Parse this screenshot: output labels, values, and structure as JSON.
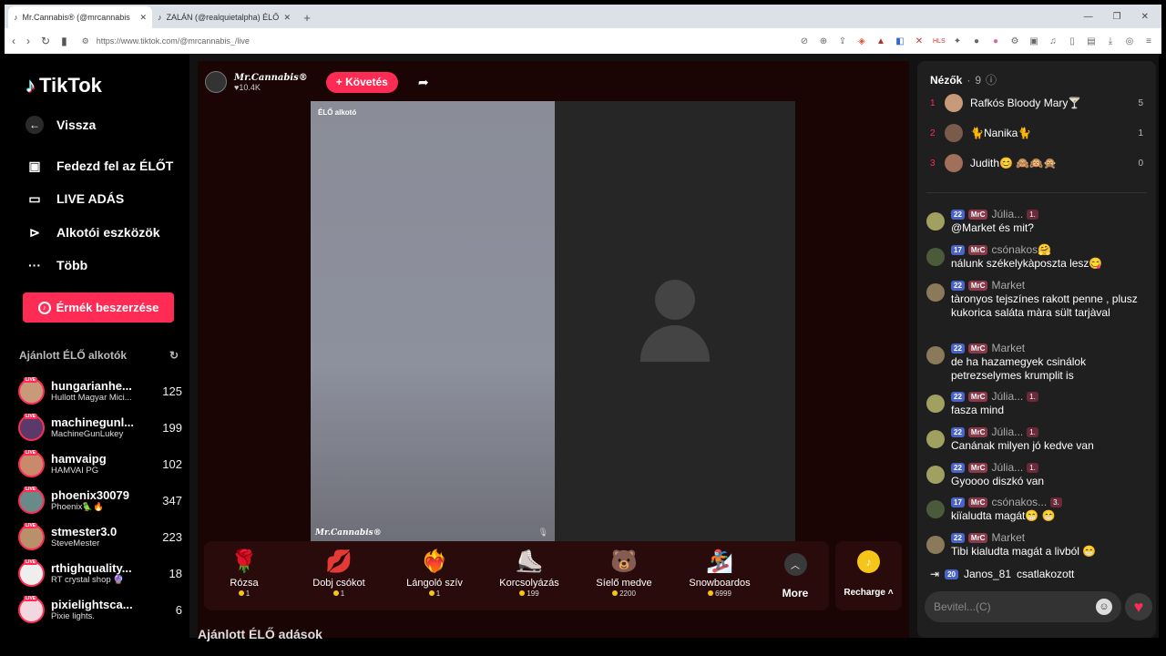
{
  "browser": {
    "tabs": [
      {
        "title": "Mr.Cannabis® (@mrcannabis"
      },
      {
        "title": "ZALÁN (@realquietalpha) ÉLŐ"
      }
    ],
    "url": "https://www.tiktok.com/@mrcannabis_/live"
  },
  "sidebar": {
    "logo": "TikTok",
    "nav": [
      {
        "label": "Vissza",
        "icon": "arrow-left-icon"
      },
      {
        "label": "Fedezd fel az ÉLŐT",
        "icon": "calendar-live-icon"
      },
      {
        "label": "LIVE ADÁS",
        "icon": "video-camera-icon"
      },
      {
        "label": "Alkotói eszközök",
        "icon": "play-circle-icon"
      },
      {
        "label": "Több",
        "icon": "more-dots-icon"
      }
    ],
    "coins_button": "Érmék beszerzése",
    "recommended_heading": "Ajánlott ÉLŐ alkotók",
    "creators": [
      {
        "handle": "hungarianhe...",
        "name": "Hullott Magyar Mici...",
        "count": "125"
      },
      {
        "handle": "machinegunl...",
        "name": "MachineGunLukey",
        "count": "199"
      },
      {
        "handle": "hamvaipg",
        "name": "HAMVAI PG",
        "count": "102"
      },
      {
        "handle": "phoenix30079",
        "name": "Phoenix🦜🔥",
        "count": "347"
      },
      {
        "handle": "stmester3.0",
        "name": "SteveMester",
        "count": "223"
      },
      {
        "handle": "rthighquality...",
        "name": "RT crystal shop 🔮",
        "count": "18"
      },
      {
        "handle": "pixielightsca...",
        "name": "Pixie lights.",
        "count": "6"
      }
    ]
  },
  "stream": {
    "host_name": "Mr.Cannabis®",
    "likes": "10.4K",
    "follow_label": "+ Követés",
    "video_tag": "ÉLŐ alkotó",
    "watermark": "Mr.Cannabis®",
    "recommended_streams_heading": "Ajánlott ÉLŐ adások"
  },
  "gifts": [
    {
      "name": "Rózsa",
      "price": "1",
      "icon": "🌹"
    },
    {
      "name": "Dobj csókot",
      "price": "1",
      "icon": "💋"
    },
    {
      "name": "Lángoló szív",
      "price": "1",
      "icon": "❤️‍🔥"
    },
    {
      "name": "Korcsolyázás",
      "price": "199",
      "icon": "⛸️"
    },
    {
      "name": "Síelő medve",
      "price": "2200",
      "icon": "🐻"
    },
    {
      "name": "Snowboardos",
      "price": "6999",
      "icon": "🏂"
    }
  ],
  "gift_more": "More",
  "recharge": "Recharge",
  "chat": {
    "viewers_label": "Nézők",
    "viewers_count": "9",
    "top_viewers": [
      {
        "rank": "1",
        "name": "Rafkós Bloody Mary🍸",
        "score": "5"
      },
      {
        "rank": "2",
        "name": "🐈Nanika🐈",
        "score": "1"
      },
      {
        "rank": "3",
        "name": "Judith😊 🙈🙉🙊",
        "score": "0"
      }
    ],
    "messages": [
      {
        "level": "22",
        "fan": "MrC",
        "user": "Júlia...",
        "sub": "1.",
        "text": "@Market és mit?"
      },
      {
        "level": "17",
        "fan": "MrC",
        "user": "csónakos🤗",
        "sub": "",
        "text": "nálunk székelykàposzta lesz😋"
      },
      {
        "level": "22",
        "fan": "MrC",
        "user": "Market",
        "sub": "",
        "text": "tàronyos tejszínes rakott penne , plusz kukorica saláta màra sült tarjàval"
      },
      {
        "level": "22",
        "fan": "MrC",
        "user": "Market",
        "sub": "",
        "text": "de ha hazamegyek csinálok petrezselymes krumplit is"
      },
      {
        "level": "22",
        "fan": "MrC",
        "user": "Júlia...",
        "sub": "1.",
        "text": "fasza mind"
      },
      {
        "level": "22",
        "fan": "MrC",
        "user": "Júlia...",
        "sub": "1.",
        "text": "Canának milyen jó kedve van"
      },
      {
        "level": "22",
        "fan": "MrC",
        "user": "Júlia...",
        "sub": "1.",
        "text": "Gyoooo diszkó van"
      },
      {
        "level": "17",
        "fan": "MrC",
        "user": "csónakos...",
        "sub": "3.",
        "text": "kiïaludta magát😁 😁"
      },
      {
        "level": "22",
        "fan": "MrC",
        "user": "Market",
        "sub": "",
        "text": "Tibi kialudta magát a livból 😁"
      }
    ],
    "join": {
      "level": "20",
      "user": "Janos_81",
      "action": "csatlakozott"
    },
    "input_placeholder": "Bevitel...(C)"
  }
}
